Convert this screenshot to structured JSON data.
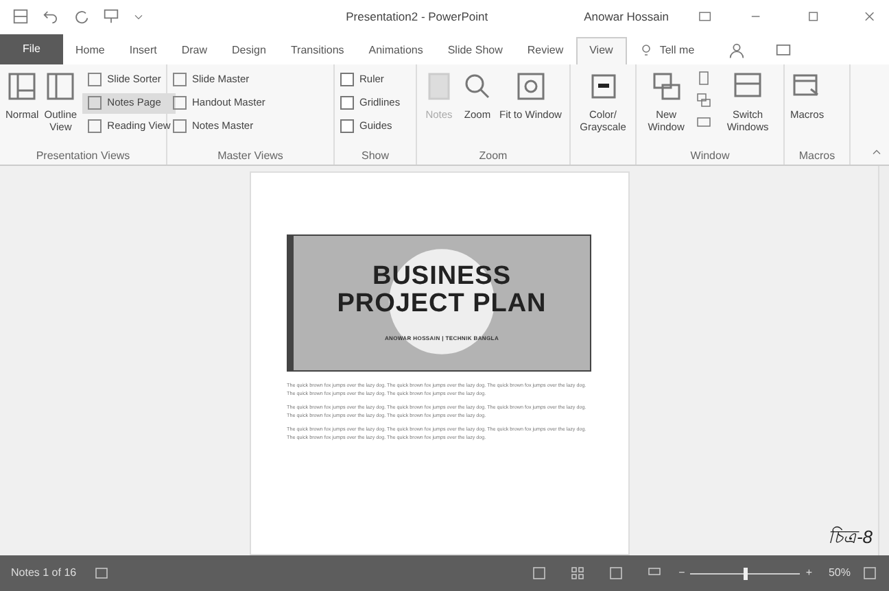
{
  "title_bar": {
    "title": "Presentation2 - PowerPoint",
    "user": "Anowar Hossain"
  },
  "tabs": [
    {
      "label": "File",
      "kind": "file",
      "selected": false
    },
    {
      "label": "Home",
      "kind": "tab",
      "selected": false
    },
    {
      "label": "Insert",
      "kind": "tab",
      "selected": false
    },
    {
      "label": "Draw",
      "kind": "tab",
      "selected": false
    },
    {
      "label": "Design",
      "kind": "tab",
      "selected": false
    },
    {
      "label": "Transitions",
      "kind": "tab",
      "selected": false
    },
    {
      "label": "Animations",
      "kind": "tab",
      "selected": false
    },
    {
      "label": "Slide Show",
      "kind": "tab",
      "selected": false
    },
    {
      "label": "Review",
      "kind": "tab",
      "selected": false
    },
    {
      "label": "View",
      "kind": "tab",
      "selected": true
    },
    {
      "label": "Tell me",
      "kind": "tell",
      "selected": false
    }
  ],
  "ribbon": {
    "presentation_views": {
      "label": "Presentation Views",
      "large": [
        "Normal",
        "Outline View"
      ],
      "small": [
        {
          "label": "Slide Sorter",
          "selected": false
        },
        {
          "label": "Notes Page",
          "selected": true
        },
        {
          "label": "Reading View",
          "selected": false
        }
      ]
    },
    "master_views": {
      "label": "Master Views",
      "items": [
        "Slide Master",
        "Handout Master",
        "Notes Master"
      ]
    },
    "show": {
      "label": "Show",
      "items": [
        {
          "label": "Ruler",
          "checked": false
        },
        {
          "label": "Gridlines",
          "checked": false
        },
        {
          "label": "Guides",
          "checked": false
        }
      ]
    },
    "zoom": {
      "label": "Zoom",
      "notes": "Notes",
      "zoom": "Zoom",
      "fit": "Fit to Window"
    },
    "color": {
      "label": "Color/ Grayscale"
    },
    "window": {
      "label": "Window",
      "new": "New Window",
      "switch": "Switch Windows"
    },
    "macros": {
      "label": "Macros",
      "button": "Macros"
    }
  },
  "notes_page": {
    "title_line_1": "BUSINESS",
    "title_line_2": "PROJECT PLAN",
    "subtitle": "ANOWAR HOSSAIN | TECHNIK BANGLA",
    "paragraphs": [
      "The quick brown fox jumps over the lazy dog. The quick brown fox jumps over the lazy dog. The quick brown fox jumps over the lazy dog. The quick brown fox jumps over the lazy dog. The quick brown fox jumps over the lazy dog.",
      "The quick brown fox jumps over the lazy dog. The quick brown fox jumps over the lazy dog. The quick brown fox jumps over the lazy dog. The quick brown fox jumps over the lazy dog. The quick brown fox jumps over the lazy dog.",
      "The quick brown fox jumps over the lazy dog. The quick brown fox jumps over the lazy dog. The quick brown fox jumps over the lazy dog. The quick brown fox jumps over the lazy dog. The quick brown fox jumps over the lazy dog."
    ]
  },
  "caption": "চিত্র-8",
  "status_bar": {
    "page": "Notes 1 of 16",
    "zoom_percent": "50%",
    "zoom": {
      "level": 0.5
    },
    "zoom_out": "−",
    "zoom_in": "+"
  }
}
